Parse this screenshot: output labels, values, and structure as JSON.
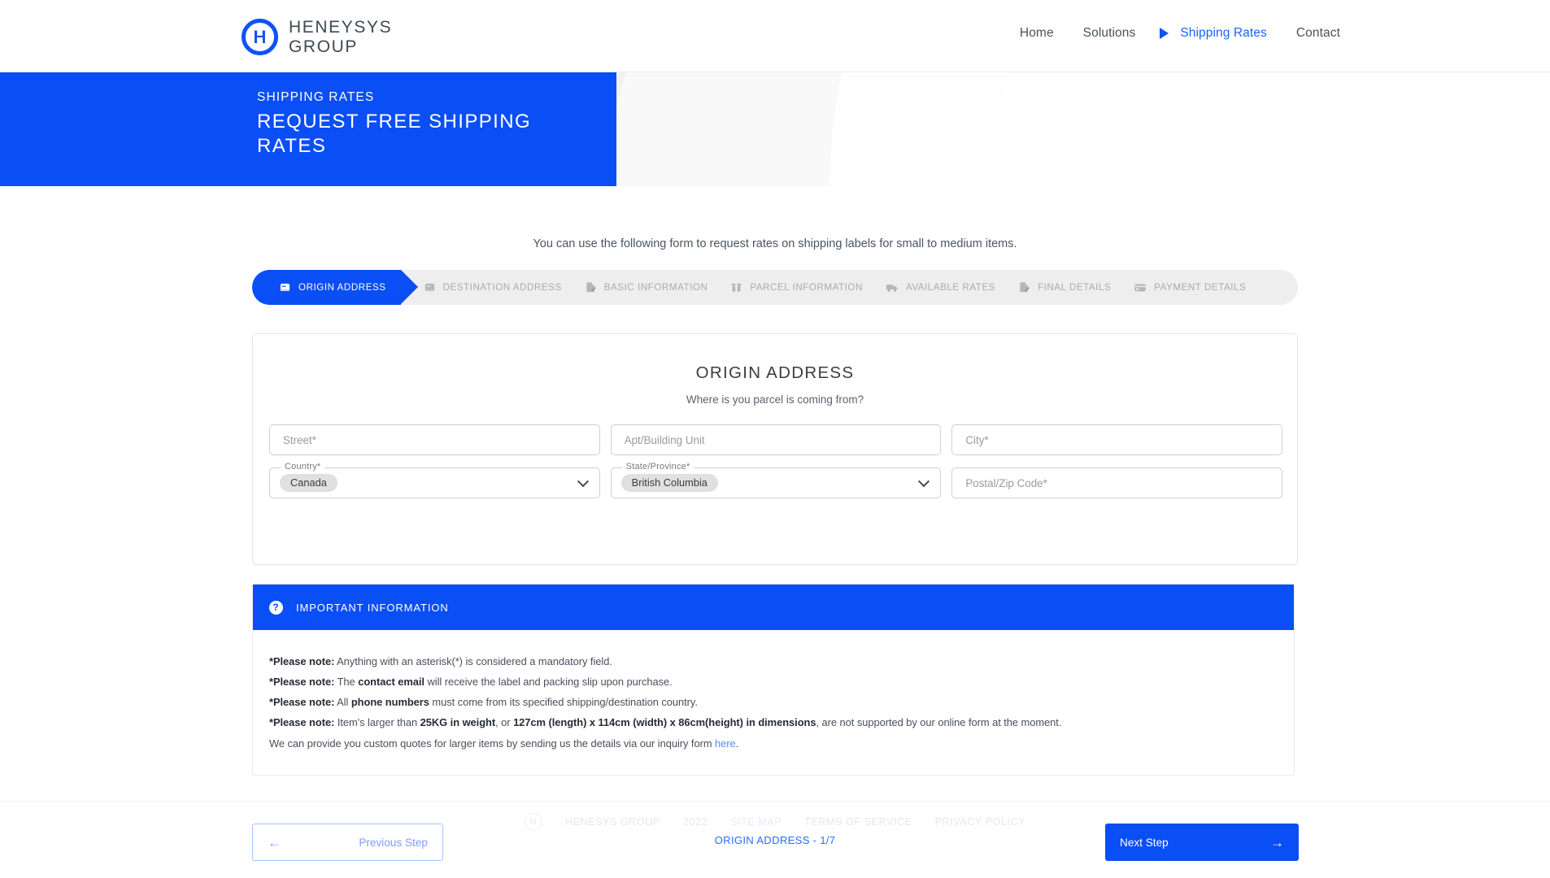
{
  "brand": {
    "logo_line1": "HENEYSYS",
    "logo_line2": "GROUP",
    "logo_letter": "H"
  },
  "nav": {
    "items": [
      {
        "label": "Home",
        "active": false
      },
      {
        "label": "Solutions",
        "active": false
      },
      {
        "label": "Shipping Rates",
        "active": true
      },
      {
        "label": "Contact",
        "active": false
      }
    ]
  },
  "hero": {
    "eyebrow": "SHIPPING RATES",
    "title": "REQUEST FREE SHIPPING RATES"
  },
  "intro": {
    "text": "You can use the following form to request rates on shipping labels for small to medium items."
  },
  "stepper": {
    "steps": [
      {
        "label": "ORIGIN ADDRESS",
        "icon": "mailbox-icon",
        "active": true
      },
      {
        "label": "DESTINATION ADDRESS",
        "icon": "mailbox-icon",
        "active": false
      },
      {
        "label": "BASIC INFORMATION",
        "icon": "signature-icon",
        "active": false
      },
      {
        "label": "PARCEL INFORMATION",
        "icon": "box-icon",
        "active": false
      },
      {
        "label": "AVAILABLE RATES",
        "icon": "truck-icon",
        "active": false
      },
      {
        "label": "FINAL DETAILS",
        "icon": "signature-icon",
        "active": false
      },
      {
        "label": "PAYMENT DETAILS",
        "icon": "credit-card-icon",
        "active": false
      }
    ]
  },
  "form": {
    "title": "ORIGIN ADDRESS",
    "subtitle": "Where is you parcel is coming from?",
    "street": {
      "placeholder": "Street*",
      "value": ""
    },
    "apt": {
      "placeholder": "Apt/Building Unit",
      "value": ""
    },
    "city": {
      "placeholder": "City*",
      "value": ""
    },
    "country": {
      "label": "Country*",
      "value": "Canada"
    },
    "state": {
      "label": "State/Province*",
      "value": "British Columbia"
    },
    "postal": {
      "placeholder": "Postal/Zip Code*",
      "value": ""
    }
  },
  "info": {
    "heading": "IMPORTANT INFORMATION",
    "icon": "question-circle-icon",
    "notes": [
      {
        "prefix": "*Please note:",
        "text": " Anything with an asterisk(*) is considered a mandatory field."
      },
      {
        "prefix": "*Please note:",
        "text": " The ",
        "bold": "contact email",
        "text2": " will receive the label and packing slip upon purchase."
      },
      {
        "prefix": "*Please note:",
        "text": " All ",
        "bold": "phone numbers",
        "text2": " must come from its specified shipping/destination country."
      },
      {
        "prefix": "*Please note:",
        "text": " Item's larger than ",
        "bold": "25KG in weight",
        "text2": ", or ",
        "bold2": "127cm (length) x 114cm (width) x 86cm(height) in dimensions",
        "text3": ", are not supported by our online form at the moment."
      }
    ],
    "closing_text": "We can provide you custom quotes for larger items by sending us the details via our inquiry form ",
    "closing_link": "here",
    "closing_end": "."
  },
  "footer": {
    "brand": "HENESYS GROUP",
    "year": "2022",
    "links": [
      "SITE MAP",
      "TERMS OF SERVICE",
      "PRIVACY POLICY"
    ]
  },
  "wizard": {
    "status": "ORIGIN ADDRESS - 1/7",
    "prev_label": "Previous Step",
    "next_label": "Next Step",
    "prev_arrow": "←",
    "next_arrow": "→"
  },
  "colors": {
    "brand_blue": "#0a4ef5",
    "link_blue": "#4f8df7",
    "hero_grey": "#f1f1f2"
  }
}
